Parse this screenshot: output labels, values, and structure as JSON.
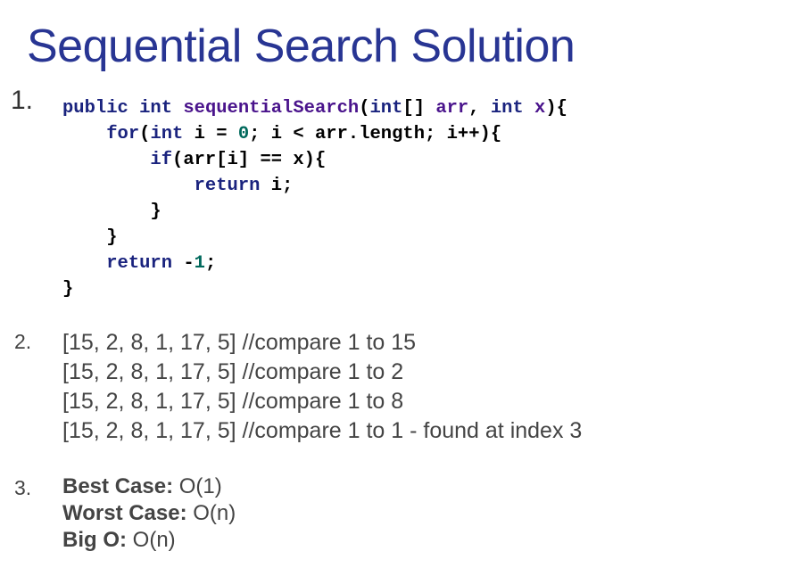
{
  "title": "Sequential Search Solution",
  "items": [
    {
      "number": "1."
    },
    {
      "number": "2."
    },
    {
      "number": "3."
    }
  ],
  "code": {
    "lines": [
      [
        {
          "t": "public",
          "c": "kw"
        },
        {
          "t": " ",
          "c": "pl"
        },
        {
          "t": "int",
          "c": "kw"
        },
        {
          "t": " ",
          "c": "pl"
        },
        {
          "t": "sequentialSearch",
          "c": "fn"
        },
        {
          "t": "(",
          "c": "pl"
        },
        {
          "t": "int",
          "c": "kw"
        },
        {
          "t": "[] ",
          "c": "pl"
        },
        {
          "t": "arr",
          "c": "fn"
        },
        {
          "t": ", ",
          "c": "pl"
        },
        {
          "t": "int",
          "c": "kw"
        },
        {
          "t": " ",
          "c": "pl"
        },
        {
          "t": "x",
          "c": "fn"
        },
        {
          "t": "){",
          "c": "pl"
        }
      ],
      [
        {
          "t": "    ",
          "c": "pl"
        },
        {
          "t": "for",
          "c": "kw"
        },
        {
          "t": "(",
          "c": "pl"
        },
        {
          "t": "int",
          "c": "kw"
        },
        {
          "t": " i = ",
          "c": "pl"
        },
        {
          "t": "0",
          "c": "num"
        },
        {
          "t": "; i < arr.length; i++){",
          "c": "pl"
        }
      ],
      [
        {
          "t": "        ",
          "c": "pl"
        },
        {
          "t": "if",
          "c": "kw"
        },
        {
          "t": "(arr[i] == x){",
          "c": "pl"
        }
      ],
      [
        {
          "t": "            ",
          "c": "pl"
        },
        {
          "t": "return",
          "c": "kw"
        },
        {
          "t": " i;",
          "c": "pl"
        }
      ],
      [
        {
          "t": "        }",
          "c": "pl"
        }
      ],
      [
        {
          "t": "    }",
          "c": "pl"
        }
      ],
      [
        {
          "t": "    ",
          "c": "pl"
        },
        {
          "t": "return",
          "c": "kw"
        },
        {
          "t": " -",
          "c": "pl"
        },
        {
          "t": "1",
          "c": "num"
        },
        {
          "t": ";",
          "c": "pl"
        }
      ],
      [
        {
          "t": "}",
          "c": "pl"
        }
      ]
    ]
  },
  "trace": [
    "[15, 2, 8, 1, 17, 5] //compare 1 to 15",
    "[15, 2, 8, 1, 17, 5] //compare 1 to 2",
    "[15, 2, 8, 1, 17, 5] //compare 1 to 8",
    "[15, 2, 8, 1, 17, 5] //compare 1 to 1 - found at index 3"
  ],
  "complexity": {
    "best_label": "Best Case:",
    "best_value": " O(1)",
    "worst_label": "Worst Case:",
    "worst_value": " O(n)",
    "bigo_label": "Big O:",
    "bigo_value": " O(n)"
  },
  "colors": {
    "title": "#283593",
    "keyword": "#1a237e",
    "identifier": "#4a148c",
    "number": "#00695c",
    "body_text": "#444444"
  }
}
